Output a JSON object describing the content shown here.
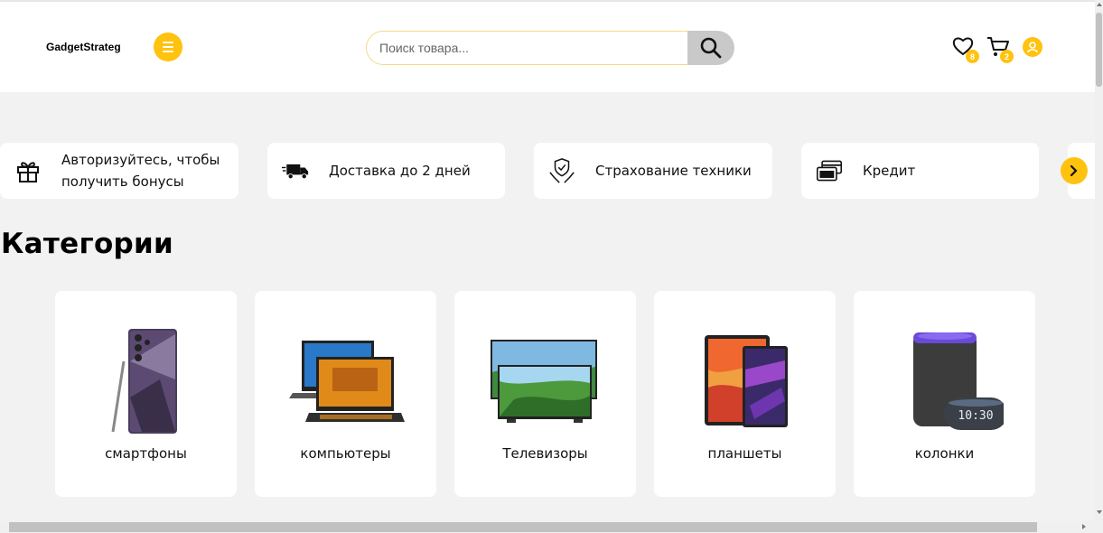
{
  "header": {
    "logo": "GadgetStrateg",
    "search_placeholder": "Поиск товара...",
    "favorites_count": "8",
    "cart_count": "2"
  },
  "promos": [
    {
      "label": "Авторизуйтесь, чтобы получить бонусы",
      "icon": "gift-icon"
    },
    {
      "label": "Доставка до 2 дней",
      "icon": "delivery-truck-icon"
    },
    {
      "label": "Страхование техники",
      "icon": "insurance-shield-icon"
    },
    {
      "label": "Кредит",
      "icon": "credit-cards-icon"
    }
  ],
  "categories_title": "Категории",
  "categories": [
    {
      "label": "смартфоны",
      "icon": "smartphone-image"
    },
    {
      "label": "компьютеры",
      "icon": "laptop-image"
    },
    {
      "label": "Телевизоры",
      "icon": "tv-image"
    },
    {
      "label": "планшеты",
      "icon": "tablet-image"
    },
    {
      "label": "колонки",
      "icon": "smart-speaker-image"
    }
  ],
  "speaker_clock": "10:30",
  "colors": {
    "accent": "#ffc20e",
    "search_button": "#c9c9c9"
  }
}
